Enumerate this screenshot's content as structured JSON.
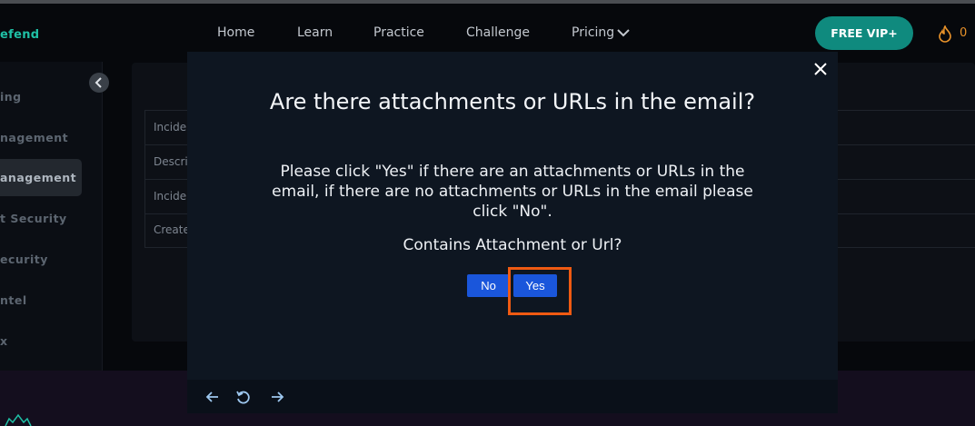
{
  "navbar": {
    "logo": "efend",
    "items": [
      "Home",
      "Learn",
      "Practice",
      "Challenge",
      "Pricing"
    ],
    "vip_label": "FREE VIP+",
    "streak_count": "0"
  },
  "sidebar": {
    "items": [
      "ing",
      "nagement",
      "anagement",
      "t Security",
      "ecurity",
      "ntel",
      "x"
    ]
  },
  "table": {
    "rows": [
      "Incide",
      "Descri",
      "Incide",
      "Create"
    ]
  },
  "modal": {
    "title": "Are there attachments or URLs in the email?",
    "description": "Please click \"Yes\" if there are an attachments or URLs in the email, if there are no attachments or URLs in the email please click \"No\".",
    "question": "Contains Attachment or Url?",
    "no_label": "No",
    "yes_label": "Yes"
  },
  "icons": {
    "close": "close-icon",
    "back": "arrow-left-icon",
    "reset": "rotate-ccw-icon",
    "forward": "arrow-right-icon",
    "collapse": "chevron-left-icon",
    "streak": "flame-icon"
  },
  "colors": {
    "accent_teal": "#0f8a7e",
    "button_blue": "#1a56db",
    "highlight_orange": "#ef5a12",
    "streak_orange": "#e8922a"
  }
}
